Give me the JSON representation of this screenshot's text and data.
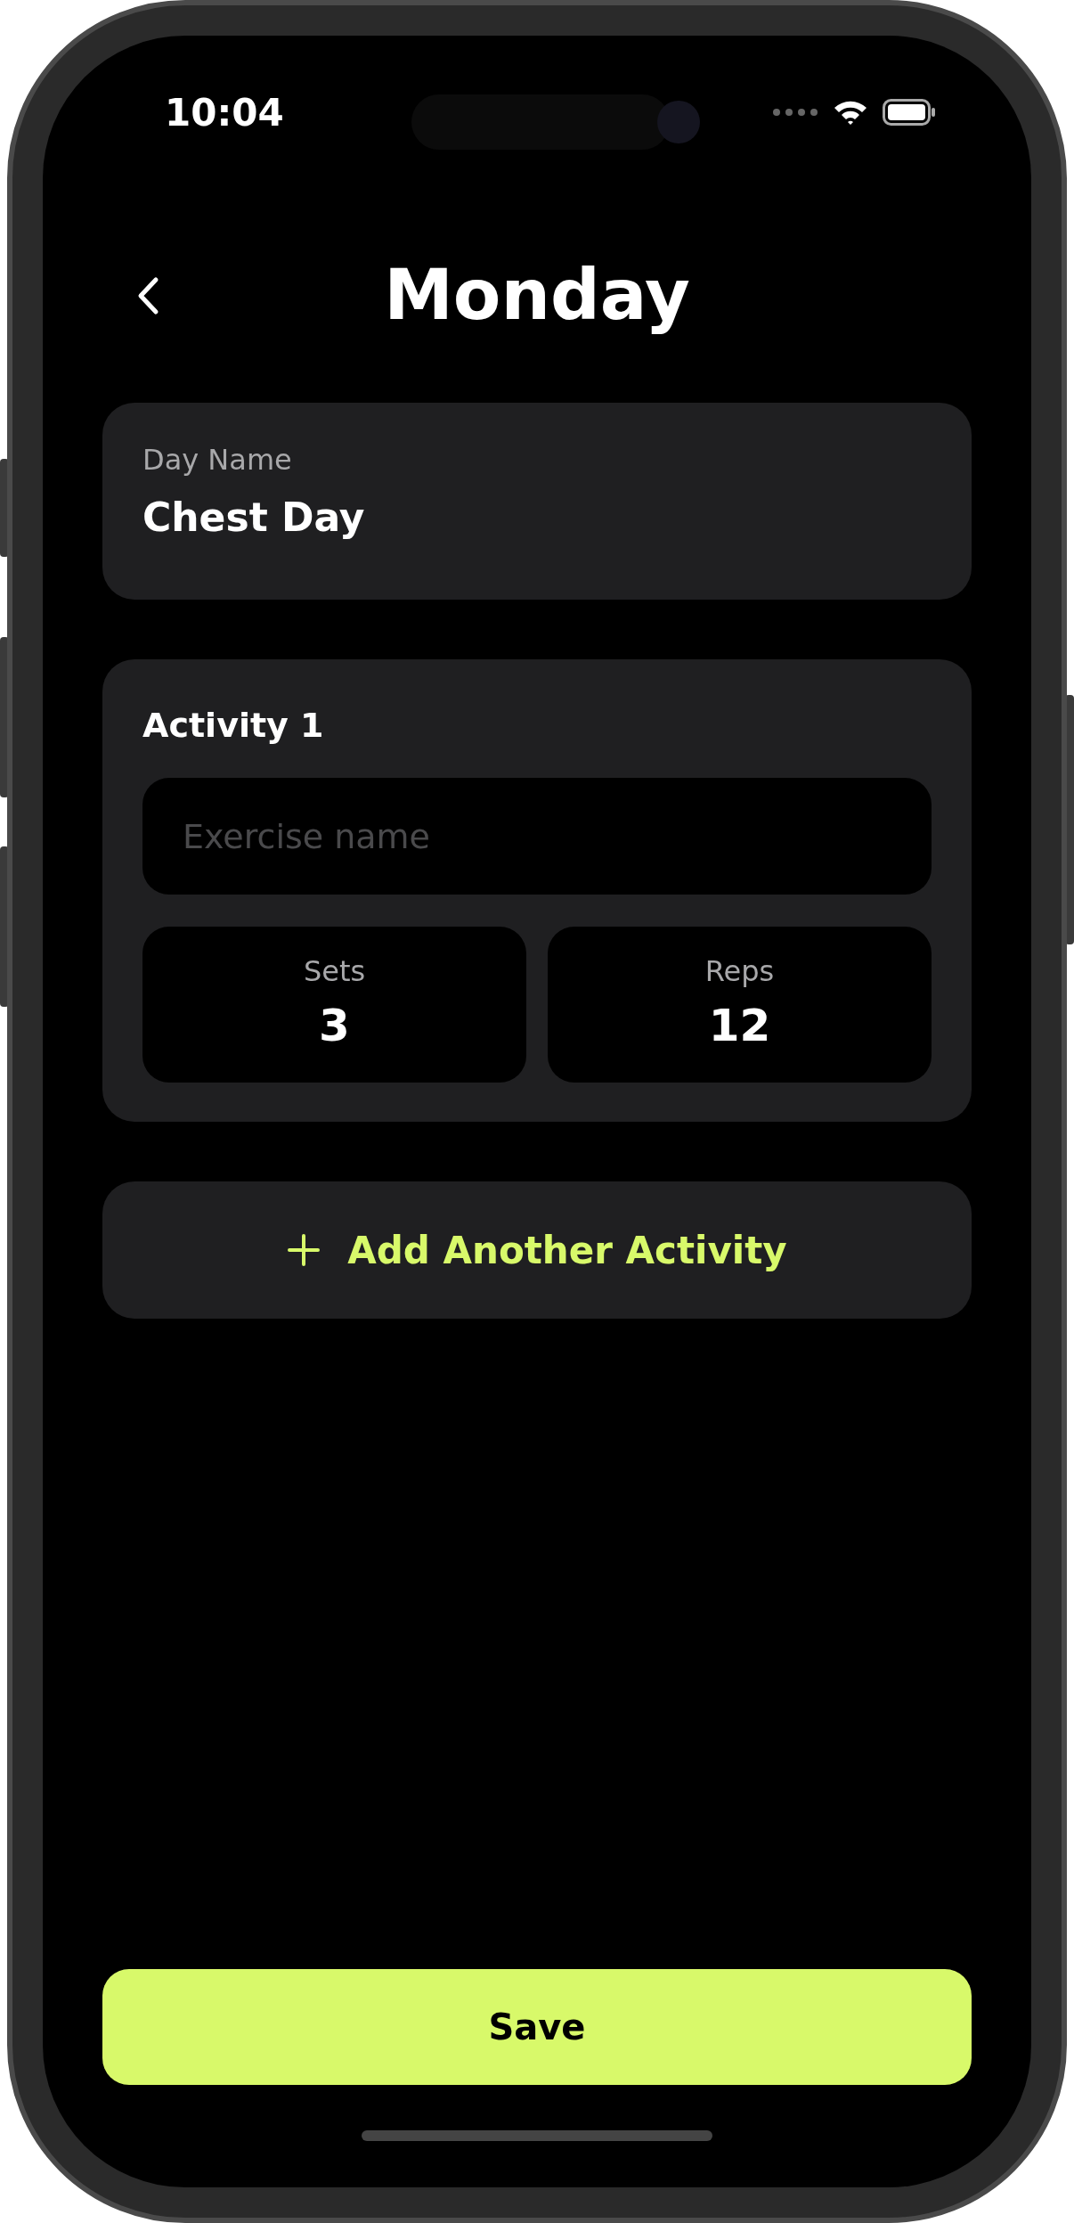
{
  "status_bar": {
    "time": "10:04"
  },
  "header": {
    "title": "Monday"
  },
  "day_name": {
    "label": "Day Name",
    "value": "Chest Day"
  },
  "activities": [
    {
      "title": "Activity 1",
      "exercise": {
        "placeholder": "Exercise name"
      },
      "sets": {
        "label": "Sets",
        "value": "3"
      },
      "reps": {
        "label": "Reps",
        "value": "12"
      }
    }
  ],
  "add_button": {
    "label": "Add Another Activity"
  },
  "save_button": {
    "label": "Save"
  }
}
